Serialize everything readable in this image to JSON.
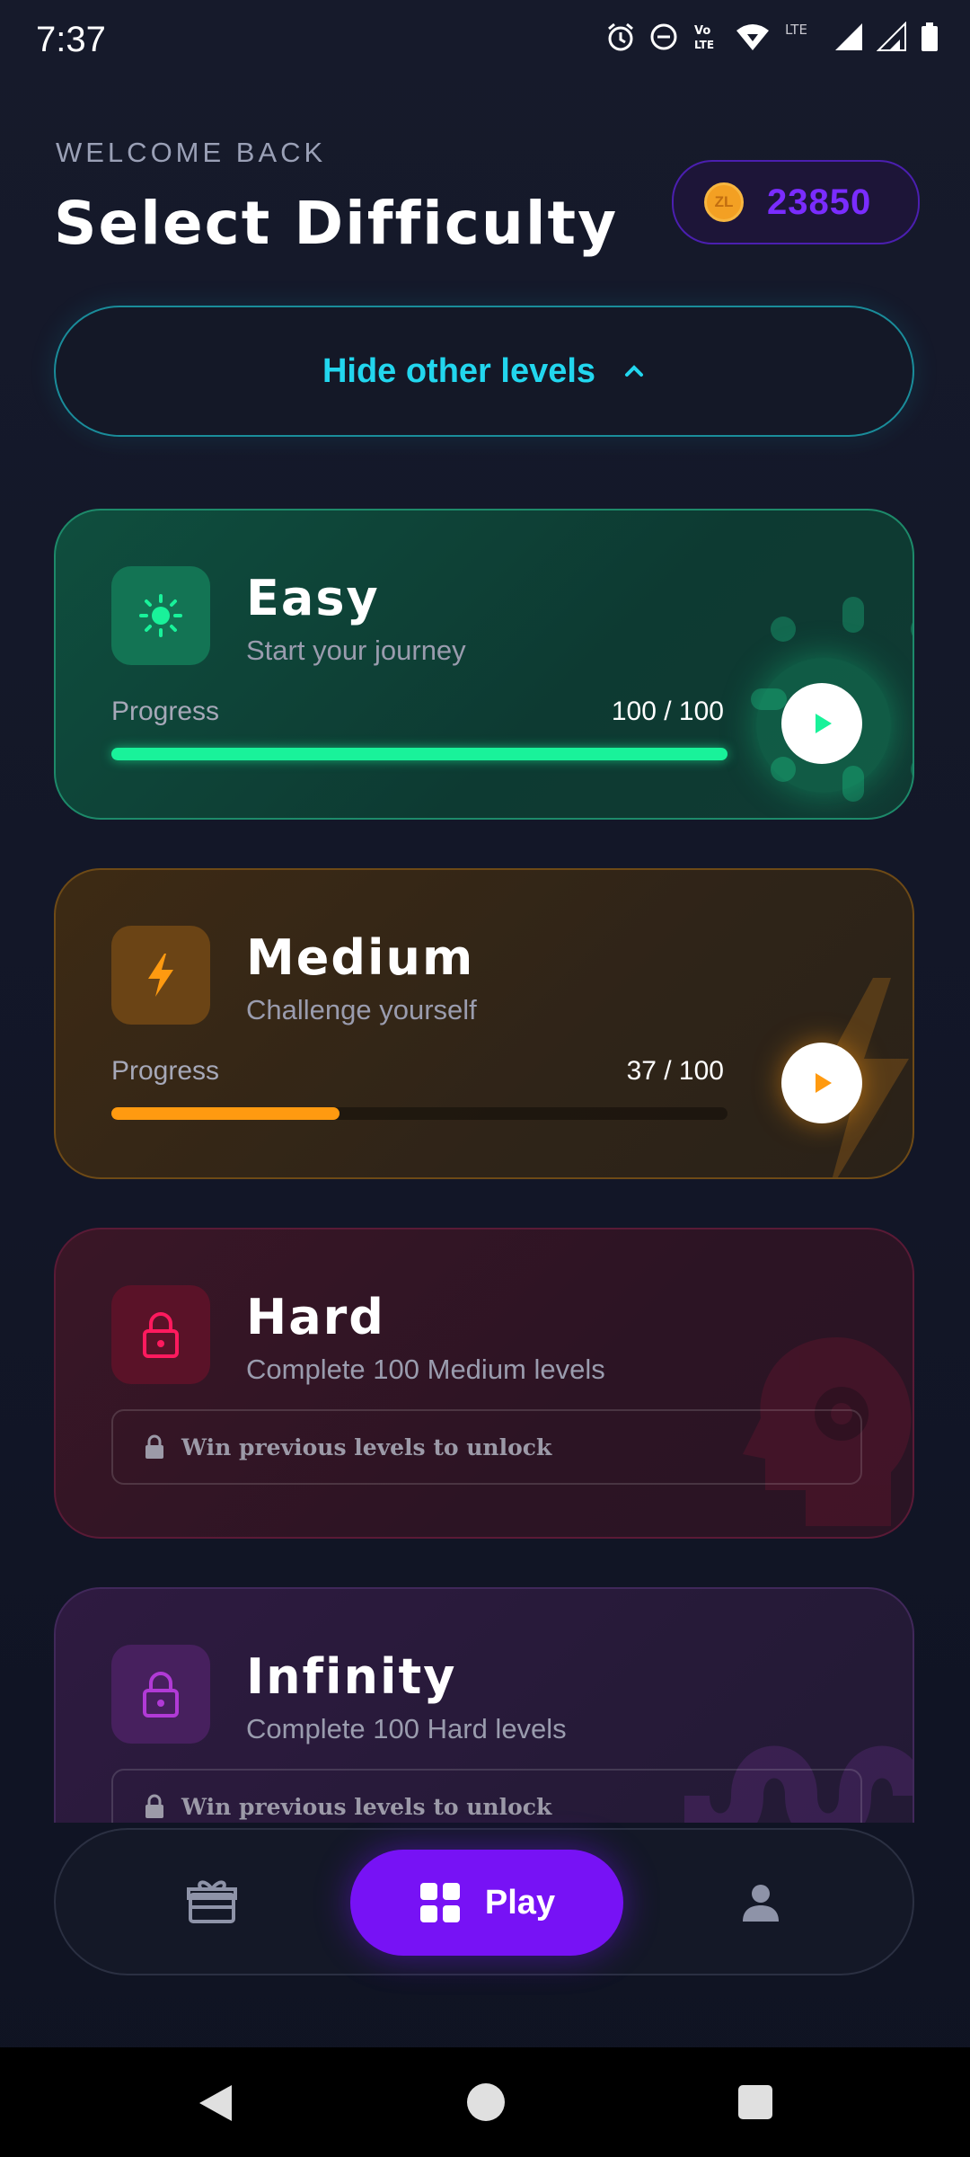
{
  "status_bar": {
    "time": "7:37",
    "icons": [
      "alarm-icon",
      "dnd-icon",
      "volte-icon",
      "wifi-icon",
      "signal-icon",
      "signal-icon",
      "battery-icon"
    ],
    "volte_label_top": "Vo",
    "volte_label_bottom": "LTE",
    "lte_label": "LTE"
  },
  "header": {
    "welcome": "WELCOME BACK",
    "title": "Select Difficulty",
    "coin_icon_label": "ZL",
    "coins": "23850"
  },
  "toggle": {
    "label": "Hide other levels",
    "icon": "chevron-up-icon"
  },
  "levels": [
    {
      "name": "Easy",
      "subtitle": "Start your journey",
      "progress_label": "Progress",
      "progress_text": "100 / 100",
      "progress": 1.0,
      "locked": false,
      "accent": "#19f29a",
      "icon": "sun-icon"
    },
    {
      "name": "Medium",
      "subtitle": "Challenge yourself",
      "progress_label": "Progress",
      "progress_text": "37 / 100",
      "progress": 0.37,
      "locked": false,
      "accent": "#ff9a10",
      "icon": "bolt-icon"
    },
    {
      "name": "Hard",
      "subtitle": "Complete 100 Medium levels",
      "locked": true,
      "lock_text": "Win previous levels to unlock",
      "accent": "#ff1a5e",
      "icon": "lock-icon"
    },
    {
      "name": "Infinity",
      "subtitle": "Complete 100 Hard levels",
      "locked": true,
      "lock_text": "Win previous levels to unlock",
      "accent": "#b13ad6",
      "icon": "lock-icon"
    }
  ],
  "bottom_nav": {
    "left_icon": "gift-icon",
    "play_label": "Play",
    "play_icon": "grid-icon",
    "right_icon": "profile-icon",
    "accent": "#7712f5"
  },
  "system_nav": [
    "back-icon",
    "home-icon",
    "recents-icon"
  ]
}
